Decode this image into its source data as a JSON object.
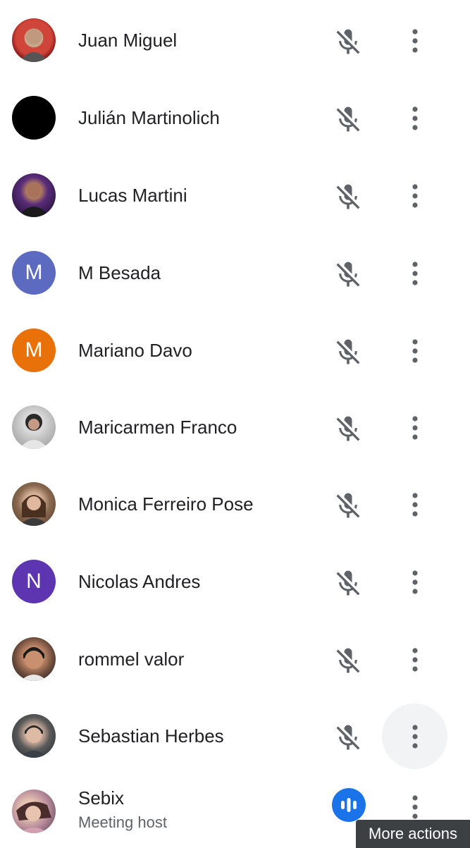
{
  "participants": [
    {
      "name": "Juan Miguel",
      "avatar": "photo-red-background"
    },
    {
      "name": "Julián Martinolich",
      "avatar": "photo-black"
    },
    {
      "name": "Lucas Martini",
      "avatar": "photo-purple"
    },
    {
      "name": "M Besada",
      "avatar_letter": "M",
      "avatar_color": "#5c6bc0"
    },
    {
      "name": "Mariano Davo",
      "avatar_letter": "M",
      "avatar_color": "#e8710a"
    },
    {
      "name": "Maricarmen Franco",
      "avatar": "photo-gray"
    },
    {
      "name": "Monica Ferreiro Pose",
      "avatar": "photo-warm"
    },
    {
      "name": "Nicolas Andres",
      "avatar_letter": "N",
      "avatar_color": "#5e35b1"
    },
    {
      "name": "rommel valor",
      "avatar": "photo-portrait"
    },
    {
      "name": "Sebastian Herbes",
      "avatar": "photo-dark"
    },
    {
      "name": "Sebix",
      "subtitle": "Meeting host",
      "avatar": "photo-pink"
    }
  ],
  "icons": {
    "muted": "mic-off-icon",
    "more": "more-vert-icon",
    "speaking": "audio-level-icon"
  },
  "colors": {
    "icon_gray": "#5f6368",
    "speaking_blue": "#1a73e8"
  },
  "tooltip": {
    "text": "More actions"
  }
}
